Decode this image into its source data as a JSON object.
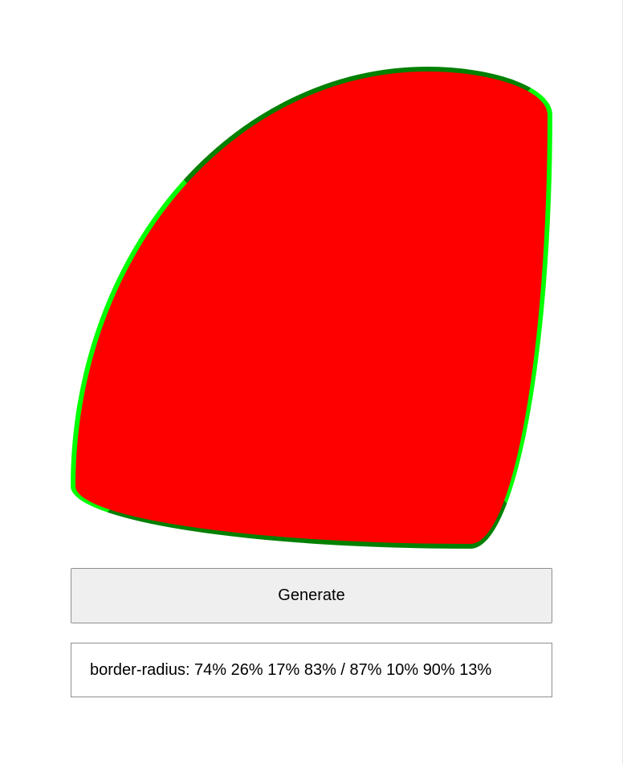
{
  "shape": {
    "fill_color": "#ff0000",
    "border_colors": {
      "top": "#008000",
      "right": "#00ff00",
      "bottom": "#008000",
      "left": "#00ff00"
    },
    "border_radius_css": "74% 26% 17% 83% / 87% 10% 90% 13%"
  },
  "generate_button": {
    "label": "Generate"
  },
  "output": {
    "text": "border-radius: 74% 26% 17% 83% / 87% 10% 90% 13%"
  }
}
